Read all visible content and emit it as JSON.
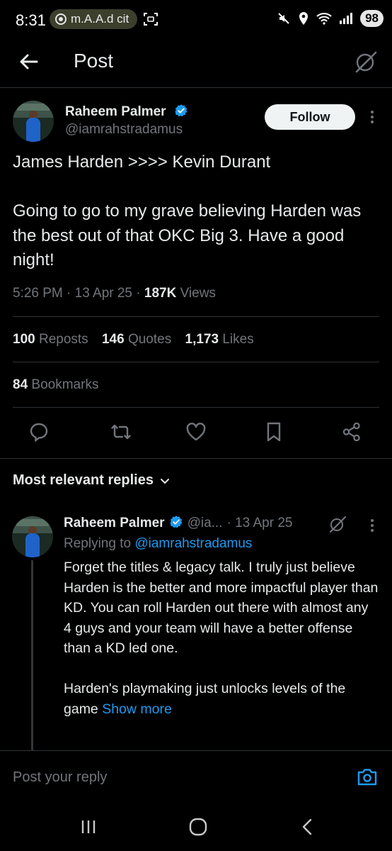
{
  "status_bar": {
    "time": "8:31",
    "media_title": "m.A.A.d cit",
    "battery": "98"
  },
  "header": {
    "title": "Post"
  },
  "post": {
    "author_name": "Raheem Palmer",
    "author_handle": "@iamrahstradamus",
    "follow_label": "Follow",
    "text_line1": "James Harden >>>> Kevin Durant",
    "text_para2": "Going to go to my grave believing Harden was the best out of that OKC Big 3. Have a good night!",
    "time": "5:26 PM",
    "date": "13 Apr 25",
    "views_count": "187K",
    "views_label": "Views",
    "reposts_count": "100",
    "reposts_label": "Reposts",
    "quotes_count": "146",
    "quotes_label": "Quotes",
    "likes_count": "1,173",
    "likes_label": "Likes",
    "bookmarks_count": "84",
    "bookmarks_label": "Bookmarks"
  },
  "replies": {
    "sort_label": "Most relevant replies",
    "items": [
      {
        "author_name": "Raheem Palmer",
        "author_handle": "@ia...",
        "date": "· 13 Apr 25",
        "replying_prefix": "Replying to",
        "replying_handle": "@iamrahstradamus",
        "para1": "Forget the titles & legacy talk. I truly just believe Harden is the better and more impactful player than KD. You can roll Harden out there with almost any 4 guys and your team will have a better offense  than a KD led one.",
        "para2": "Harden's playmaking just unlocks levels of the game",
        "show_more": "Show more"
      }
    ]
  },
  "compose": {
    "placeholder": "Post your reply"
  },
  "icons": {
    "accent": "#1d9bf0",
    "verified_color": "#1d9bf0"
  }
}
